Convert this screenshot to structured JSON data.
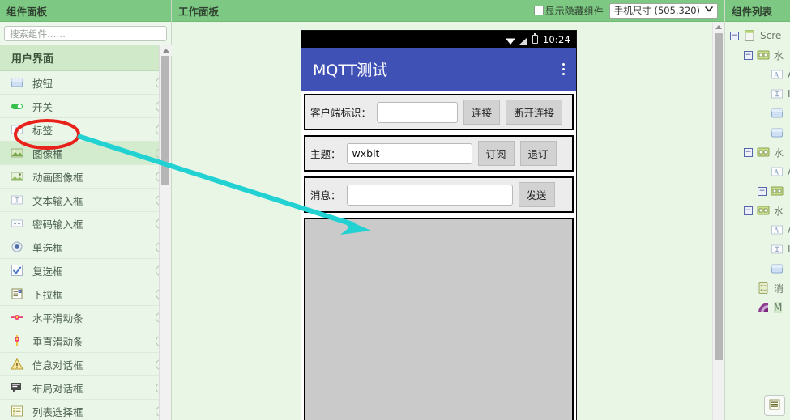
{
  "left_panel": {
    "header": "组件面板",
    "search_placeholder": "搜索组件……",
    "search_value": "",
    "section_title": "用户界面",
    "help_glyph": "?",
    "items": [
      {
        "label": "按钮",
        "icon": "button-icon",
        "hover": false
      },
      {
        "label": "开关",
        "icon": "switch-icon",
        "hover": false
      },
      {
        "label": "标签",
        "icon": "label-icon",
        "hover": false
      },
      {
        "label": "图像框",
        "icon": "image-icon",
        "hover": true
      },
      {
        "label": "动画图像框",
        "icon": "animated-image-icon",
        "hover": false
      },
      {
        "label": "文本输入框",
        "icon": "textbox-icon",
        "hover": false
      },
      {
        "label": "密码输入框",
        "icon": "password-icon",
        "hover": false
      },
      {
        "label": "单选框",
        "icon": "radio-icon",
        "hover": false
      },
      {
        "label": "复选框",
        "icon": "checkbox-icon",
        "hover": false
      },
      {
        "label": "下拉框",
        "icon": "dropdown-icon",
        "hover": false
      },
      {
        "label": "水平滑动条",
        "icon": "h-slider-icon",
        "hover": false
      },
      {
        "label": "垂直滑动条",
        "icon": "v-slider-icon",
        "hover": false
      },
      {
        "label": "信息对话框",
        "icon": "warning-icon",
        "hover": false
      },
      {
        "label": "布局对话框",
        "icon": "dialog-icon",
        "hover": false
      },
      {
        "label": "列表选择框",
        "icon": "listpicker-icon",
        "hover": false
      }
    ]
  },
  "workspace": {
    "header": "工作面板",
    "show_hidden_label": "显示隐藏组件",
    "show_hidden_checked": false,
    "size_select_value": "手机尺寸 (505,320)",
    "chevron": "❯"
  },
  "phone": {
    "status_time": "10:24",
    "app_title": "MQTT测试",
    "rows": [
      {
        "label": "客户端标识：",
        "input_value": "",
        "buttons": [
          "连接",
          "断开连接"
        ]
      },
      {
        "label": "主题：",
        "input_value": "wxbit",
        "buttons": [
          "订阅",
          "退订"
        ]
      },
      {
        "label": "消息：",
        "input_value": "",
        "buttons": [
          "发送"
        ]
      }
    ]
  },
  "right_panel": {
    "header": "组件列表",
    "nodes": [
      {
        "indent": 0,
        "expander": "−",
        "icon": "screen-icon",
        "label": "Scre",
        "selected": false
      },
      {
        "indent": 1,
        "expander": "−",
        "icon": "arrangement-icon",
        "label": "水",
        "selected": false
      },
      {
        "indent": 2,
        "expander": "",
        "icon": "label-icon",
        "label": "A",
        "selected": false
      },
      {
        "indent": 2,
        "expander": "",
        "icon": "textbox-icon",
        "label": "I",
        "selected": false
      },
      {
        "indent": 2,
        "expander": "",
        "icon": "button-icon",
        "label": "",
        "selected": false
      },
      {
        "indent": 2,
        "expander": "",
        "icon": "button-icon",
        "label": "",
        "selected": false
      },
      {
        "indent": 1,
        "expander": "−",
        "icon": "arrangement-icon",
        "label": "水",
        "selected": false
      },
      {
        "indent": 2,
        "expander": "",
        "icon": "label-icon",
        "label": "A",
        "selected": false
      },
      {
        "indent": 2,
        "expander": "−",
        "icon": "arrangement-icon",
        "label": "",
        "selected": false
      },
      {
        "indent": 1,
        "expander": "−",
        "icon": "arrangement-icon",
        "label": "水",
        "selected": false
      },
      {
        "indent": 2,
        "expander": "",
        "icon": "label-icon",
        "label": "A",
        "selected": false
      },
      {
        "indent": 2,
        "expander": "",
        "icon": "textbox-icon",
        "label": "I",
        "selected": false
      },
      {
        "indent": 2,
        "expander": "",
        "icon": "button-icon",
        "label": "",
        "selected": false
      },
      {
        "indent": 1,
        "expander": "",
        "icon": "listview-icon",
        "label": "消",
        "selected": false
      },
      {
        "indent": 1,
        "expander": "",
        "icon": "mqtt-icon",
        "label": "M",
        "selected": true
      }
    ],
    "bottom_button_icon": "rename-icon"
  },
  "annotation": {
    "ellipse_color": "#e8211b",
    "arrow_color": "#22d2d2"
  },
  "colors": {
    "header_green": "#7dc882",
    "panel_bg": "#e9f6e6",
    "section_green": "#cfe9c9",
    "appbar_blue": "#3f51b5"
  }
}
